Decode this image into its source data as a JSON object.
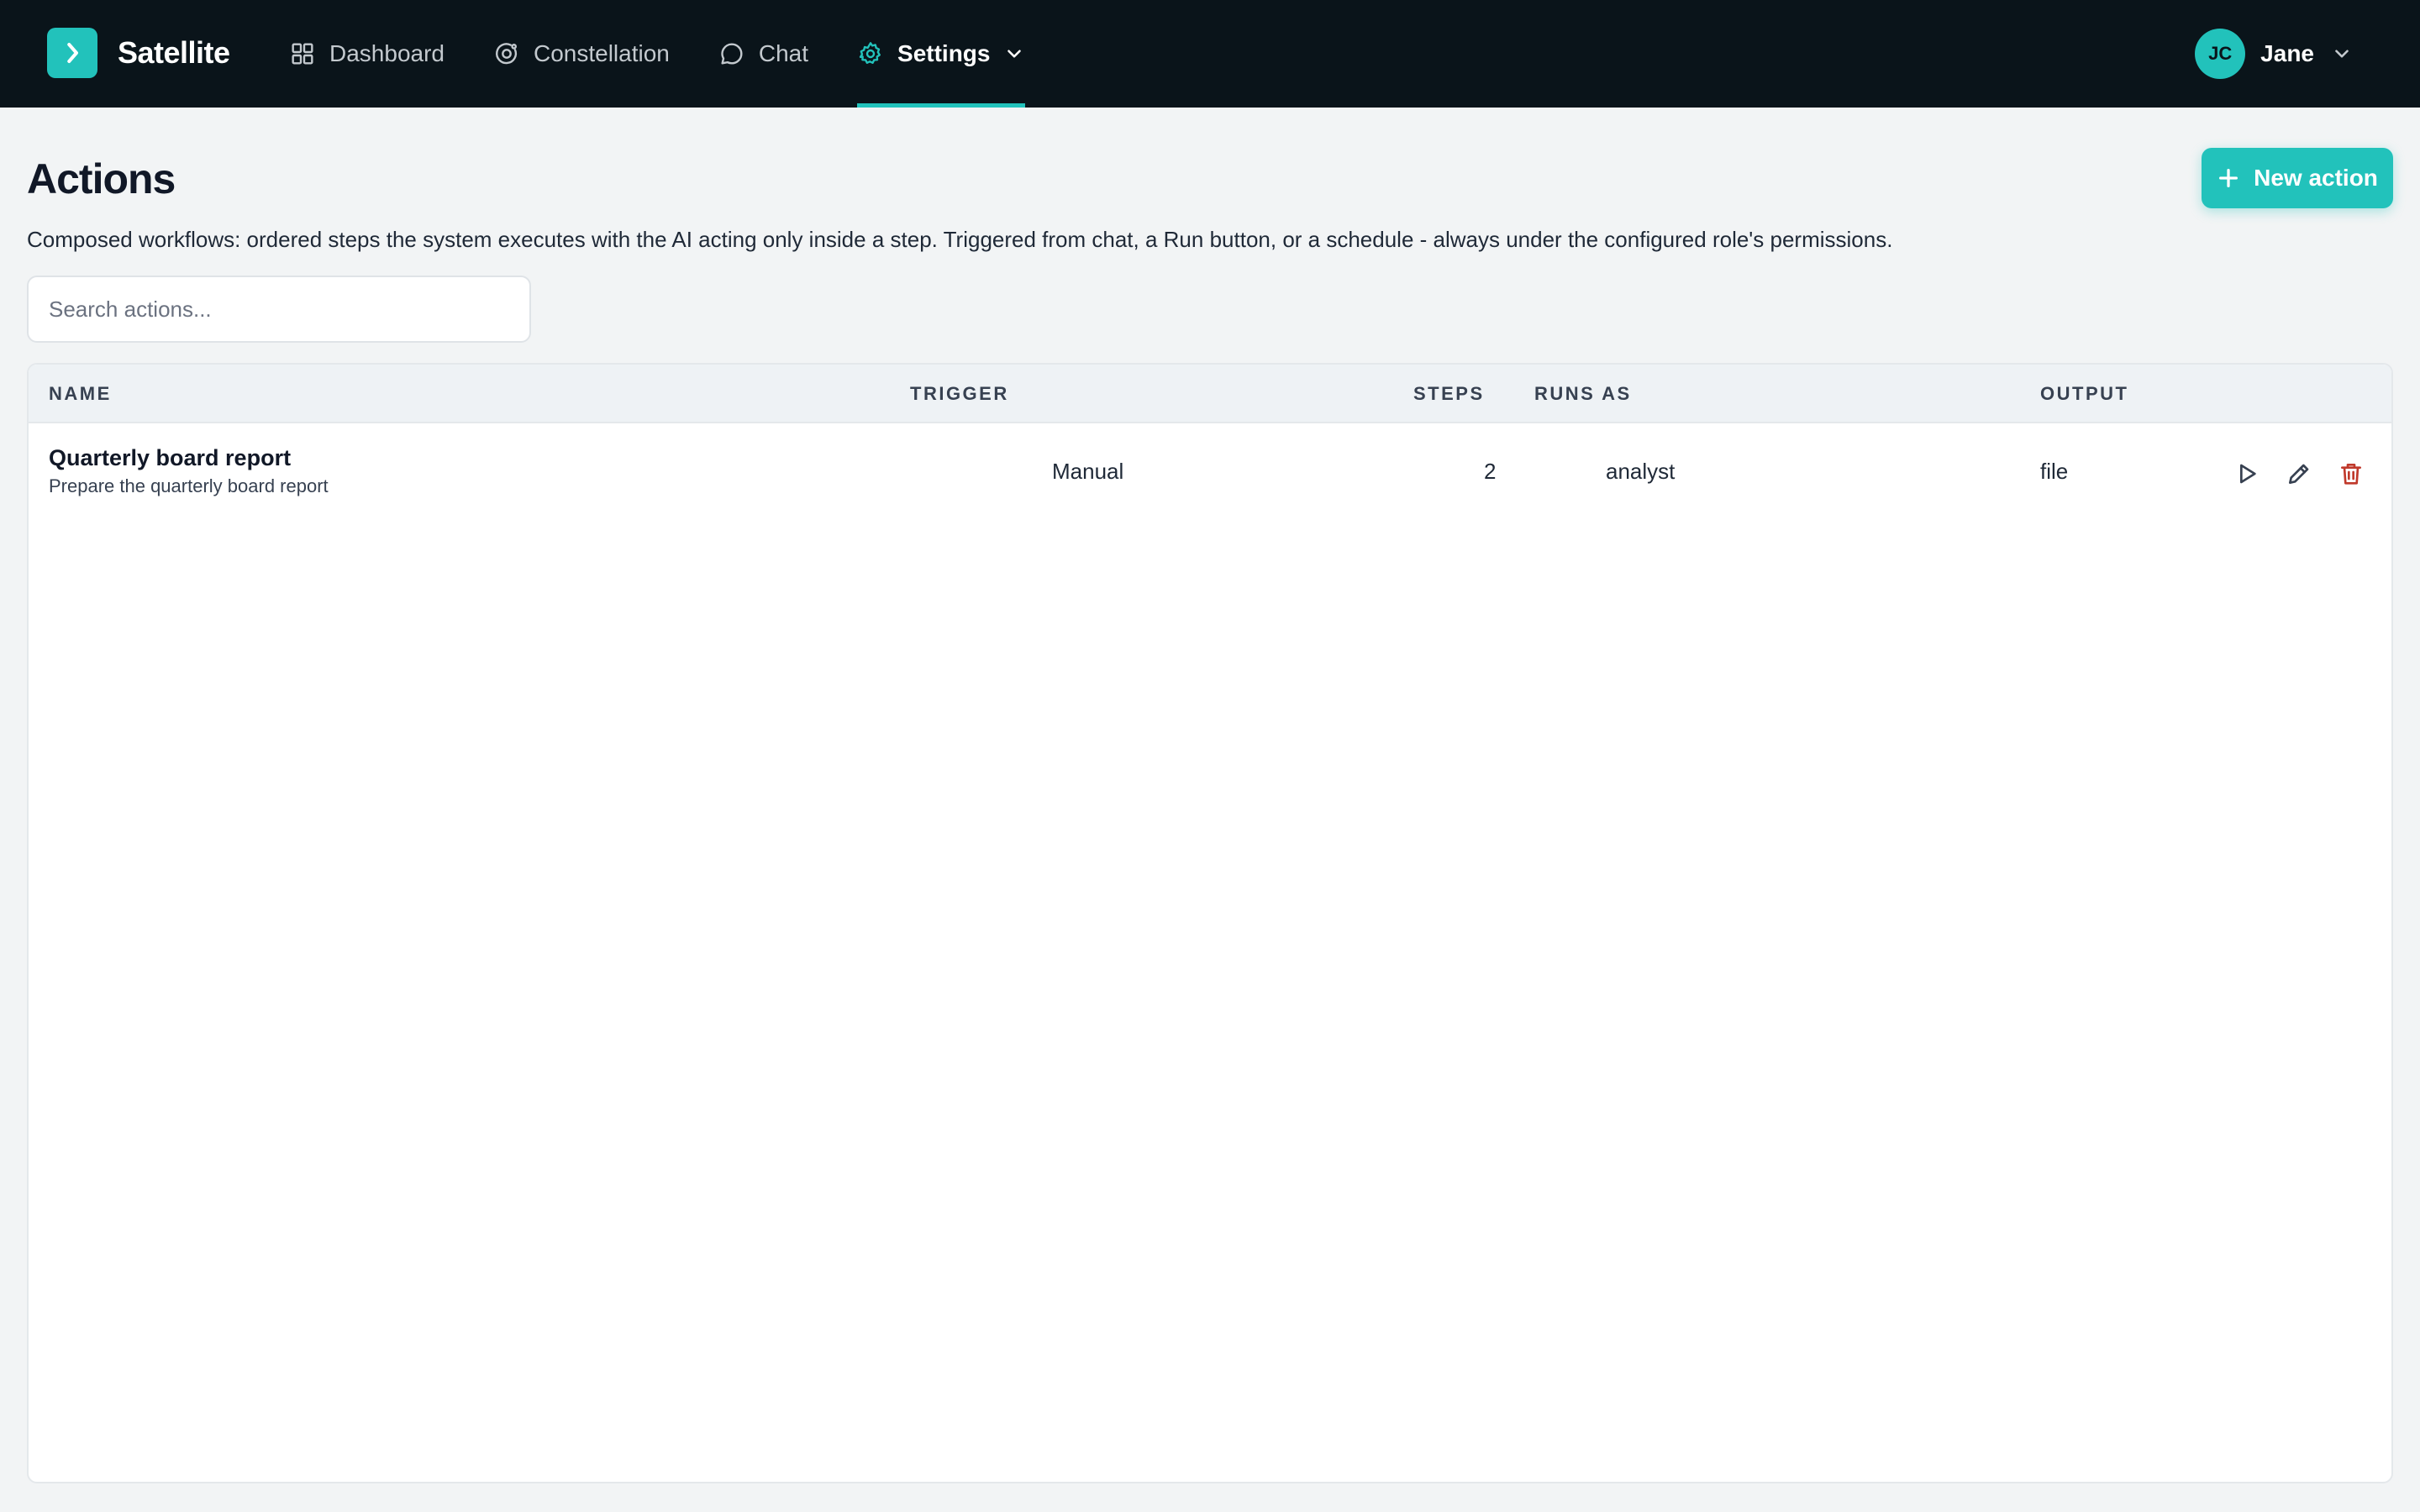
{
  "app": {
    "name": "Satellite",
    "accent_color": "#22c2bb",
    "logo_icon": "chevron-right-icon"
  },
  "nav": {
    "items": [
      {
        "label": "Dashboard",
        "icon": "grid-icon",
        "active": false
      },
      {
        "label": "Constellation",
        "icon": "orbit-icon",
        "active": false
      },
      {
        "label": "Chat",
        "icon": "chat-bubble-icon",
        "active": false
      },
      {
        "label": "Settings",
        "icon": "gear-icon",
        "active": true
      }
    ]
  },
  "user": {
    "initials": "JC",
    "name": "Jane"
  },
  "page": {
    "title": "Actions",
    "subtitle": "Composed workflows: ordered steps the system executes with the AI acting only inside a step. Triggered from chat, a Run button, or a schedule - always under the configured role's permissions.",
    "new_button_label": "New action"
  },
  "search": {
    "placeholder": "Search actions...",
    "value": ""
  },
  "table": {
    "columns": [
      "NAME",
      "TRIGGER",
      "STEPS",
      "RUNS AS",
      "OUTPUT"
    ],
    "rows": [
      {
        "name": "Quarterly board report",
        "description": "Prepare the quarterly board report",
        "trigger": "Manual",
        "steps": "2",
        "runs_as": "analyst",
        "output": "file",
        "actions": [
          "play-icon",
          "pencil-icon",
          "trash-icon"
        ]
      }
    ]
  },
  "colors": {
    "topbar_bg": "#0a141a",
    "page_bg": "#f2f4f5",
    "delete_red": "#c0392b"
  }
}
